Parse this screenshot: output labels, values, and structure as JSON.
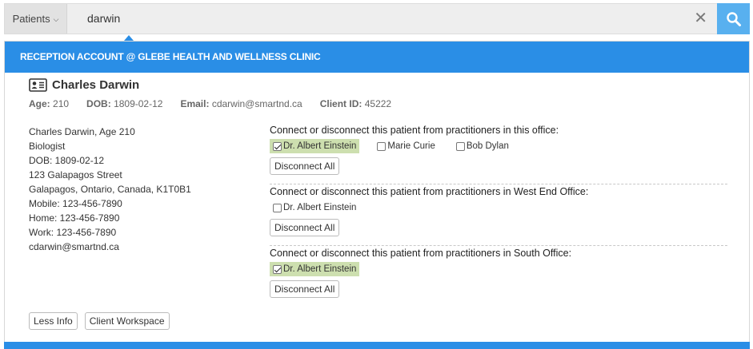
{
  "search": {
    "scope_label": "Patients",
    "query": "darwin",
    "clear_glyph": "✕"
  },
  "panel": {
    "header": "RECEPTION ACCOUNT @ GLEBE HEALTH AND WELLNESS CLINIC",
    "patient": {
      "name": "Charles Darwin",
      "age_label": "Age:",
      "age": "210",
      "dob_label": "DOB:",
      "dob": "1809-02-12",
      "email_label": "Email:",
      "email": "cdarwin@smartnd.ca",
      "client_id_label": "Client ID:",
      "client_id": "45222"
    },
    "details": [
      "Charles Darwin, Age 210",
      "Biologist",
      "DOB: 1809-02-12",
      "123 Galapagos Street",
      "Galapagos, Ontario, Canada, K1T0B1",
      "Mobile: 123-456-7890",
      "Home: 123-456-7890",
      "Work: 123-456-7890",
      "cdarwin@smartnd.ca"
    ],
    "offices": [
      {
        "title": "Connect or disconnect this patient from practitioners in this office:",
        "practitioners": [
          {
            "name": "Dr. Albert Einstein",
            "connected": true
          },
          {
            "name": "Marie Curie",
            "connected": false
          },
          {
            "name": "Bob Dylan",
            "connected": false
          }
        ],
        "disconnect_label": "Disconnect All"
      },
      {
        "title": "Connect or disconnect this patient from practitioners in West End Office:",
        "practitioners": [
          {
            "name": "Dr. Albert Einstein",
            "connected": false
          }
        ],
        "disconnect_label": "Disconnect All"
      },
      {
        "title": "Connect or disconnect this patient from practitioners in South Office:",
        "practitioners": [
          {
            "name": "Dr. Albert Einstein",
            "connected": true
          }
        ],
        "disconnect_label": "Disconnect All"
      }
    ],
    "less_info_label": "Less Info",
    "client_workspace_label": "Client Workspace"
  },
  "colors": {
    "accent": "#2a8ee6",
    "search_button": "#58b0ef",
    "connected_highlight": "#cddfaf"
  },
  "icons": [
    "chevron-down-icon",
    "close-icon",
    "search-icon",
    "contact-card-icon",
    "checkbox-icon"
  ]
}
